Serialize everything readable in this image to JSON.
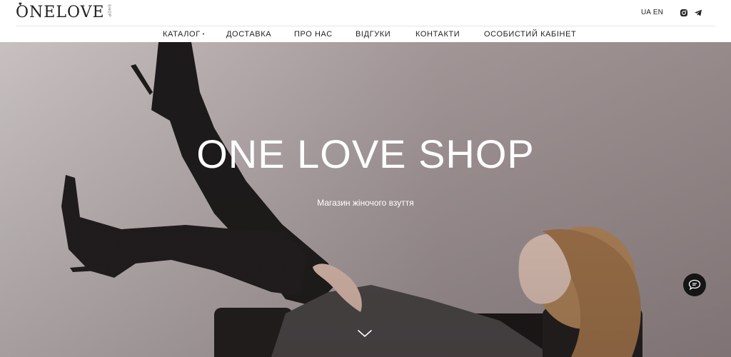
{
  "brand": {
    "logo_text": "ONELOVE",
    "logo_sub": "SHOP",
    "logo_icon": "heart-icon"
  },
  "header": {
    "languages": [
      "UA",
      "EN"
    ],
    "socials": [
      {
        "icon": "instagram-icon"
      },
      {
        "icon": "telegram-icon"
      }
    ]
  },
  "nav": {
    "items": [
      {
        "label": "КАТАЛОГ",
        "has_dropdown": true
      },
      {
        "label": "ДОСТАВКА"
      },
      {
        "label": "ПРО НАС"
      },
      {
        "label": "ВІДГУКИ"
      },
      {
        "label": "КОНТАКТИ"
      },
      {
        "label": "ОСОБИСТИЙ КАБІНЕТ"
      }
    ],
    "dropdown_marker": "•"
  },
  "hero": {
    "title": "ONE LOVE SHOP",
    "subtitle": "Магазин жіночого взуття",
    "scroll_icon": "chevron-down-icon"
  },
  "chat": {
    "icon": "chat-bubble-icon"
  },
  "colors": {
    "text": "#222222",
    "hero_text": "#ffffff",
    "chat_bg": "#151515"
  }
}
